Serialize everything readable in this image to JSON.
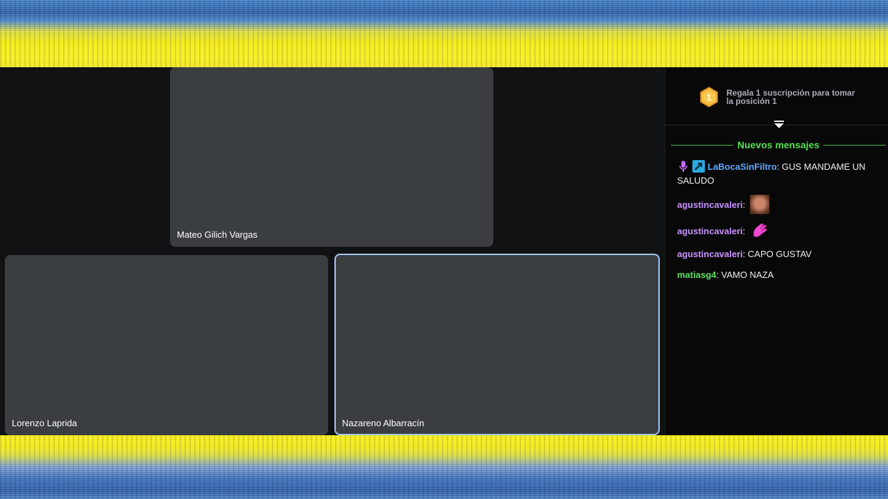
{
  "participants": [
    {
      "name": "Mateo Gilich Vargas"
    },
    {
      "name": "Lorenzo Laprida"
    },
    {
      "name": "Nazareno Albarracín"
    }
  ],
  "chat": {
    "sub_promo": {
      "badge_number": "1",
      "text": "Regala 1 suscripción para tomar la posición 1",
      "badge_icon": "gold-hexagon-rank-icon"
    },
    "collapse_icon": "chevron-filter-icon",
    "new_messages_label": "Nuevos mensajes",
    "messages": [
      {
        "user": "LaBocaSinFiltro",
        "user_color": "#5fa8ff",
        "sep": ": ",
        "text": "GUS MANDAME UN SALUDO",
        "badges": [
          "microphone-badge-icon",
          "boost-badge-icon"
        ]
      },
      {
        "user": "agustincavaleri",
        "user_color": "#c792ff",
        "sep": ": ",
        "text": "",
        "emote": "face-emote-icon"
      },
      {
        "user": "agustincavaleri",
        "user_color": "#c792ff",
        "sep": ": ",
        "text": "",
        "emote": "pink-hand-emote-icon"
      },
      {
        "user": "agustincavaleri",
        "user_color": "#c792ff",
        "sep": ": ",
        "text": "CAPO GUSTAV"
      },
      {
        "user": "matiasg4",
        "user_color": "#5ee05e",
        "sep": ": ",
        "text": "VAMO NAZA"
      }
    ],
    "colors": {
      "new_messages": "#57e057",
      "background": "#080808"
    }
  },
  "colors": {
    "tile": "#3b3e41",
    "active_border": "#a8c7fa",
    "banner_yellow": "#f3ea12",
    "banner_blue": "#2f5fa8"
  }
}
